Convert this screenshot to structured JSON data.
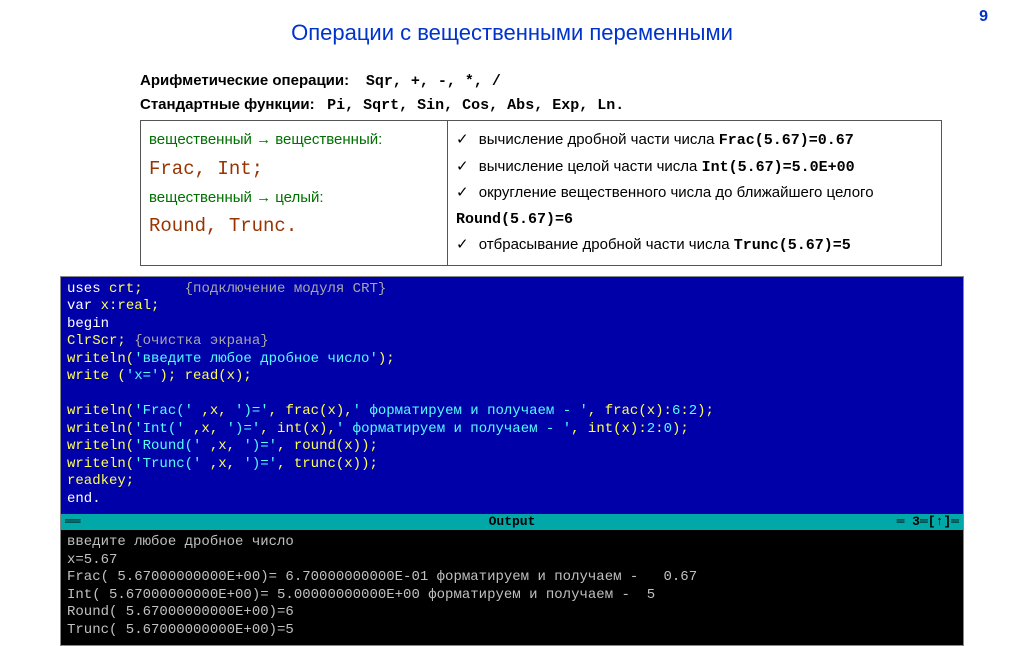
{
  "page": {
    "number": "9",
    "title": "Операции с вещественными переменными"
  },
  "definitions": {
    "arith_label": "Арифметические операции:",
    "arith_funcs": "Sqr, +, -, *, /",
    "std_label": "Стандартные функции:",
    "std_funcs": "Pi, Sqrt, Sin, Cos, Abs, Exp, Ln."
  },
  "left_col": {
    "l1": "вещественный → вещественный:",
    "l2": "Frac, Int;",
    "l3": "вещественный → целый:",
    "l4": "Round, Trunc."
  },
  "right_col": {
    "r1a": "вычисление дробной части числа ",
    "r1b": "Frac(5.67)=0.67",
    "r2a": "вычисление целой части числа ",
    "r2b": "Int(5.67)=5.0E+00",
    "r3a": "округление вещественного числа до ближайшего целого ",
    "r3b": "Round(5.67)=6",
    "r4a": "отбрасывание дробной части числа ",
    "r4b": "Trunc(5.67)=5"
  },
  "code": {
    "l1_a": "uses ",
    "l1_b": "crt;     ",
    "l1_c": "{подключение модуля CRT}",
    "l2_a": "var ",
    "l2_b": "x:real;",
    "l3": "begin",
    "l4_a": "ClrScr; ",
    "l4_b": "{очистка экрана}",
    "l5_a": "writeln(",
    "l5_b": "'введите любое дробное число'",
    "l5_c": ");",
    "l6_a": "write (",
    "l6_b": "'x='",
    "l6_c": "); read(x);",
    "blank": "",
    "l7_a": "writeln(",
    "l7_b": "'Frac(' ",
    "l7_c": ",x, ",
    "l7_d": "')='",
    "l7_e": ", frac(x),",
    "l7_f": "' форматируем и получаем - '",
    "l7_g": ", frac(x):",
    "l7_h": "6",
    "l7_i": ":",
    "l7_j": "2",
    "l7_k": ");",
    "l8_a": "writeln(",
    "l8_b": "'Int(' ",
    "l8_c": ",x, ",
    "l8_d": "')='",
    "l8_e": ", int(x),",
    "l8_f": "' форматируем и получаем - '",
    "l8_g": ", int(x):",
    "l8_h": "2",
    "l8_i": ":",
    "l8_j": "0",
    "l8_k": ");",
    "l9_a": "writeln(",
    "l9_b": "'Round(' ",
    "l9_c": ",x, ",
    "l9_d": "')='",
    "l9_e": ", round(x));",
    "l10_a": "writeln(",
    "l10_b": "'Trunc(' ",
    "l10_c": ",x, ",
    "l10_d": "')='",
    "l10_e": ", trunc(x));",
    "l11": "readkey;",
    "l12": "end."
  },
  "output_bar": "Output",
  "run": {
    "o1": "введите любое дробное число",
    "o2": "x=5.67",
    "o3": "Frac( 5.67000000000E+00)= 6.70000000000E-01 форматируем и получаем -   0.67",
    "o4": "Int( 5.67000000000E+00)= 5.00000000000E+00 форматируем и получаем -  5",
    "o5": "Round( 5.67000000000E+00)=6",
    "o6": "Trunc( 5.67000000000E+00)=5"
  }
}
